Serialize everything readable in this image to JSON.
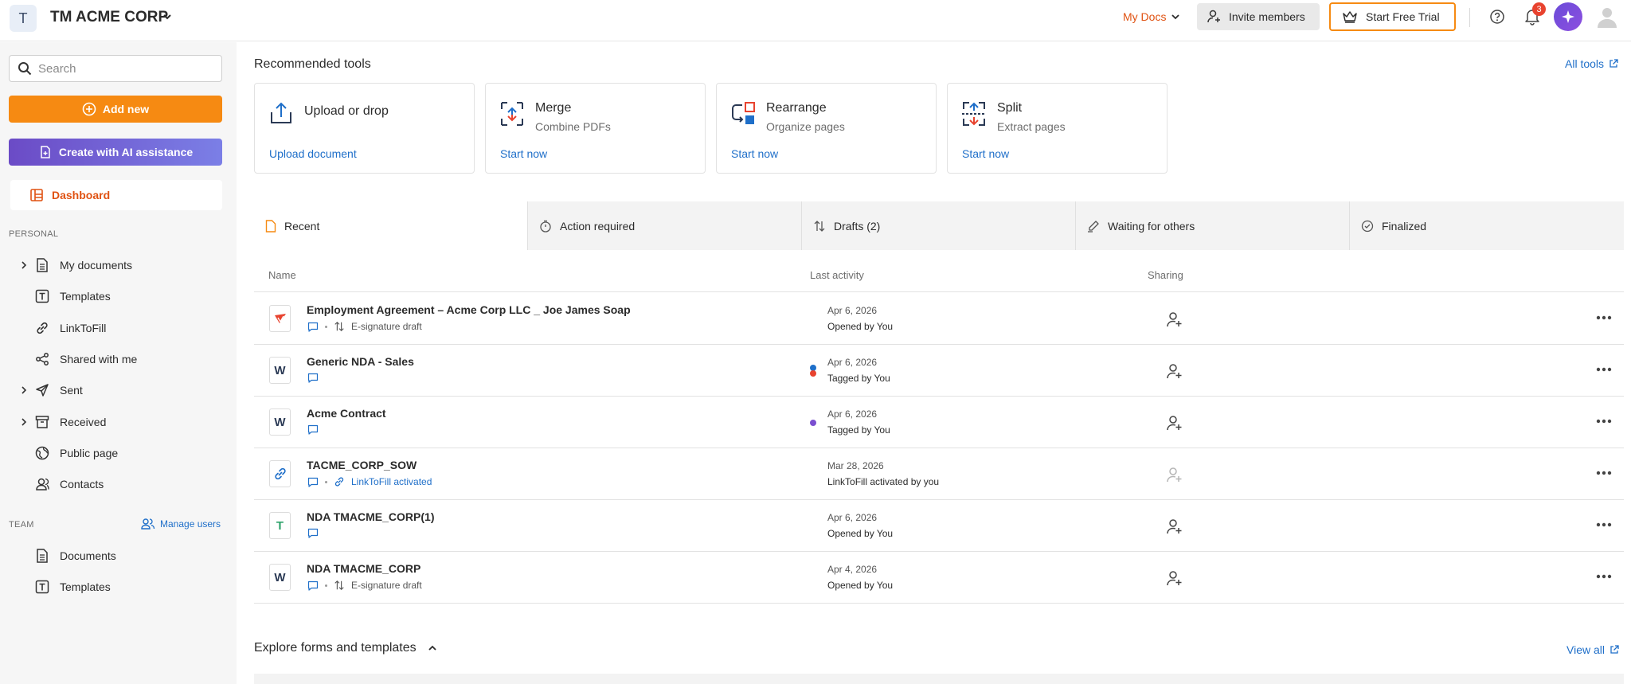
{
  "header": {
    "org_initial": "T",
    "org_name": "TM ACME CORP",
    "mydocs_label": "My Docs",
    "invite_label": "Invite members",
    "trial_label": "Start Free Trial",
    "notification_count": "3"
  },
  "sidebar": {
    "search_placeholder": "Search",
    "add_new_label": "Add new",
    "ai_create_label": "Create with AI assistance",
    "dashboard_label": "Dashboard",
    "personal_label": "PERSONAL",
    "personal_items": [
      {
        "label": "My documents",
        "icon": "document-icon",
        "expandable": true
      },
      {
        "label": "Templates",
        "icon": "template-icon",
        "expandable": false
      },
      {
        "label": "LinkToFill",
        "icon": "link-icon",
        "expandable": false
      },
      {
        "label": "Shared with me",
        "icon": "share-icon",
        "expandable": false
      },
      {
        "label": "Sent",
        "icon": "send-icon",
        "expandable": true
      },
      {
        "label": "Received",
        "icon": "inbox-icon",
        "expandable": true
      },
      {
        "label": "Public page",
        "icon": "globe-icon",
        "expandable": false
      },
      {
        "label": "Contacts",
        "icon": "contacts-icon",
        "expandable": false
      }
    ],
    "team_label": "TEAM",
    "manage_users_label": "Manage users",
    "team_items": [
      {
        "label": "Documents",
        "icon": "document-icon"
      },
      {
        "label": "Templates",
        "icon": "template-icon"
      }
    ]
  },
  "main": {
    "recommended_title": "Recommended tools",
    "all_tools_label": "All tools",
    "tools": [
      {
        "name": "Upload or drop",
        "subtitle": "",
        "link": "Upload document",
        "icon": "upload-icon"
      },
      {
        "name": "Merge",
        "subtitle": "Combine PDFs",
        "link": "Start now",
        "icon": "merge-icon"
      },
      {
        "name": "Rearrange",
        "subtitle": "Organize pages",
        "link": "Start now",
        "icon": "rearrange-icon"
      },
      {
        "name": "Split",
        "subtitle": "Extract pages",
        "link": "Start now",
        "icon": "split-icon"
      }
    ],
    "tabs": [
      {
        "label": "Recent",
        "icon": "document-icon",
        "active": true
      },
      {
        "label": "Action required",
        "icon": "timer-icon",
        "active": false
      },
      {
        "label": "Drafts (2)",
        "icon": "sort-icon",
        "active": false
      },
      {
        "label": "Waiting for others",
        "icon": "pen-icon",
        "active": false
      },
      {
        "label": "Finalized",
        "icon": "check-circle-icon",
        "active": false
      }
    ],
    "columns": {
      "name": "Name",
      "last_activity": "Last activity",
      "sharing": "Sharing"
    },
    "documents": [
      {
        "name": "Employment Agreement – Acme Corp LLC _ Joe James Soap",
        "type": "pdf",
        "meta": "E-signature draft",
        "date": "Apr 6, 2026",
        "activity": "Opened by You"
      },
      {
        "name": "Generic NDA - Sales",
        "type": "word",
        "meta": "",
        "date": "Apr 6, 2026",
        "activity": "Tagged by You"
      },
      {
        "name": "Acme Contract",
        "type": "word",
        "meta": "",
        "date": "Apr 6, 2026",
        "activity": "Tagged by You"
      },
      {
        "name": "TACME_CORP_SOW",
        "type": "link",
        "meta": "LinkToFill activated",
        "date": "Mar 28, 2026",
        "activity": "LinkToFill activated by you"
      },
      {
        "name": "NDA TMACME_CORP(1)",
        "type": "template",
        "meta": "",
        "date": "Apr 6, 2026",
        "activity": "Opened by You"
      },
      {
        "name": "NDA TMACME_CORP",
        "type": "word",
        "meta": "E-signature draft",
        "date": "Apr 4, 2026",
        "activity": "Opened by You"
      }
    ],
    "explore_title": "Explore forms and templates",
    "view_all_label": "View all"
  },
  "colors": {
    "accent_orange": "#f68a12",
    "brand_red": "#e05212",
    "link_blue": "#1f6fc9",
    "ai_purple": "#6b4bc6"
  }
}
